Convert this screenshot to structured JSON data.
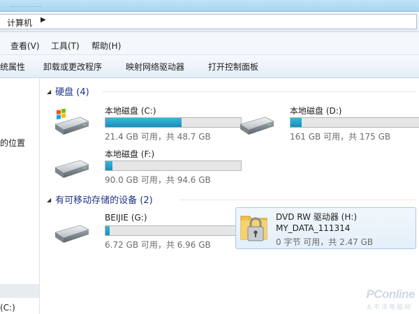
{
  "window": {
    "title_strip_text": "……………",
    "address_path": "计算机"
  },
  "menu": {
    "items": [
      {
        "label": "查看(V)"
      },
      {
        "label": "工具(T)"
      },
      {
        "label": "帮助(H)"
      }
    ]
  },
  "commands": {
    "items": [
      {
        "label": "统属性"
      },
      {
        "label": "卸载或更改程序"
      },
      {
        "label": "映射网络驱动器"
      },
      {
        "label": "打开控制面板"
      }
    ]
  },
  "nav": {
    "items": [
      {
        "label": "的位置"
      },
      {
        "label": "(C:)"
      }
    ]
  },
  "groups": {
    "hard_disks": {
      "label": "硬盘 (4)"
    },
    "removable": {
      "label": "有可移动存储的设备 (2)"
    }
  },
  "drives": [
    {
      "name": "本地磁盘 (C:)",
      "space": "21.4 GB 可用，共 48.7 GB",
      "used_fraction": 0.56
    },
    {
      "name": "本地磁盘 (D:)",
      "space": "161 GB 可用，共 175 GB",
      "used_fraction": 0.08
    },
    {
      "name": "本地磁盘 (F:)",
      "space": "90.0 GB 可用，共 94.6 GB",
      "used_fraction": 0.05
    },
    {
      "name": "BEIJIE (G:)",
      "space": "6.72 GB 可用，共 6.96 GB",
      "used_fraction": 0.03
    }
  ],
  "dvd": {
    "name": "DVD RW 驱动器 (H:)",
    "label": "MY_DATA_111314",
    "space": "0 字节 可用，共 2.47 GB"
  },
  "watermark": {
    "brand": "PConline",
    "sub": "太平洋电脑网"
  }
}
